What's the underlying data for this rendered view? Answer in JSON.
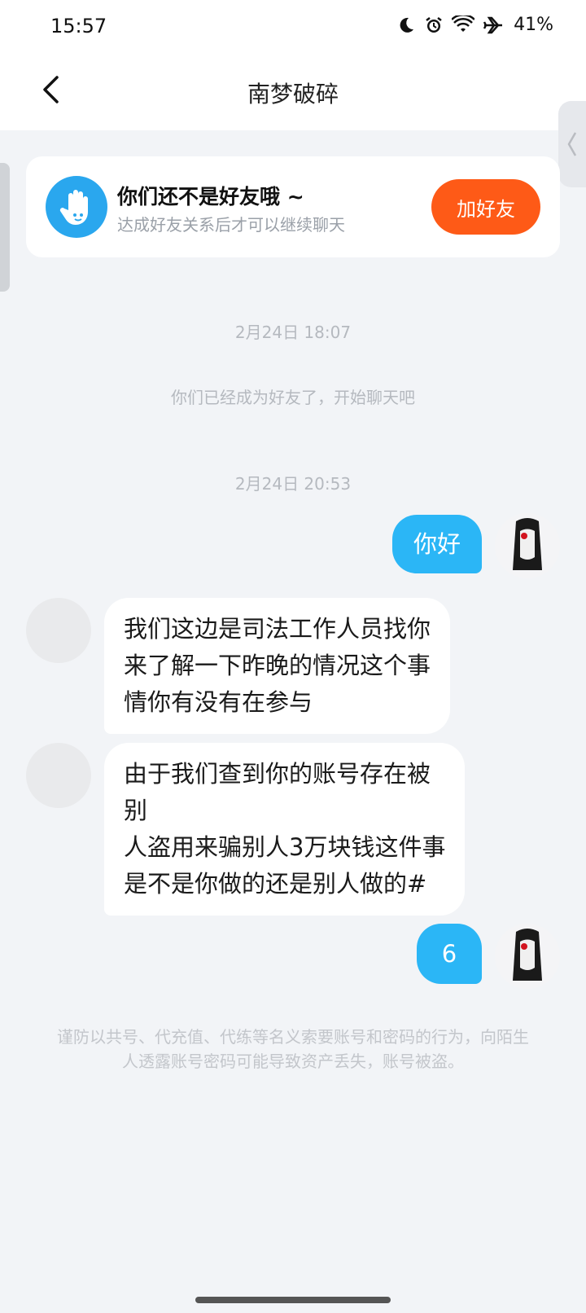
{
  "status_bar": {
    "time": "15:57",
    "battery": "41%",
    "icons": [
      "moon-icon",
      "alarm-icon",
      "wifi-icon",
      "airplane-icon"
    ]
  },
  "header": {
    "title": "南梦破碎"
  },
  "friend_card": {
    "title": "你们还不是好友哦 ~",
    "subtitle": "达成好友关系后才可以继续聊天",
    "button": "加好友"
  },
  "chat": {
    "timestamp_1": "2月24日 18:07",
    "system_message": "你们已经成为好友了，开始聊天吧",
    "timestamp_2": "2月24日 20:53",
    "messages": [
      {
        "side": "out",
        "lines": [
          "你好"
        ]
      },
      {
        "side": "in",
        "lines": [
          "我们这边是司法工作人员找你",
          "来了解一下昨晚的情况这个事",
          "情你有没有在参与"
        ]
      },
      {
        "side": "in",
        "lines": [
          "由于我们查到你的账号存在被",
          "别",
          "人盗用来骗别人3万块钱这件事",
          "是不是你做的还是别人做的#"
        ]
      },
      {
        "side": "out",
        "lines": [
          "6"
        ]
      }
    ]
  },
  "warning": "谨防以共号、代充值、代练等名义索要账号和密码的行为，向陌生人透露账号密码可能导致资产丢失，账号被盗。",
  "colors": {
    "accent_blue": "#2bb6f6",
    "button_orange": "#fe5a17",
    "background": "#f2f4f7"
  }
}
